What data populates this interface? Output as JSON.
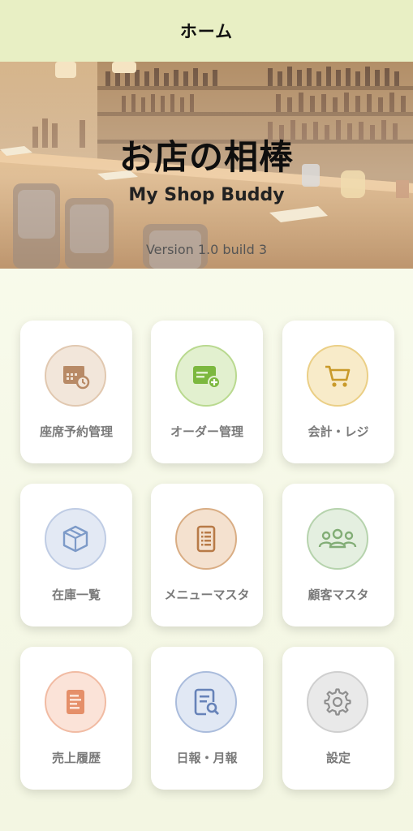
{
  "header": {
    "title": "ホーム"
  },
  "hero": {
    "title": "お店の相棒",
    "subtitle": "My Shop Buddy",
    "version": "Version 1.0 build 3"
  },
  "menu": [
    {
      "label": "座席予約管理",
      "icon": "calendar-clock-icon",
      "circle_bg": "#f2e6da",
      "circle_border": "#e1c8b0",
      "icon_color": "#b88a66"
    },
    {
      "label": "オーダー管理",
      "icon": "order-add-icon",
      "circle_bg": "#e2f0cf",
      "circle_border": "#b9d98f",
      "icon_color": "#7cb83f"
    },
    {
      "label": "会計・レジ",
      "icon": "shopping-cart-icon",
      "circle_bg": "#f8ebc9",
      "circle_border": "#ebcf86",
      "icon_color": "#c99a2a"
    },
    {
      "label": "在庫一覧",
      "icon": "box-icon",
      "circle_bg": "#e3e9f4",
      "circle_border": "#bfcce4",
      "icon_color": "#7d9ac8"
    },
    {
      "label": "メニューマスタ",
      "icon": "menu-list-icon",
      "circle_bg": "#f4e1cf",
      "circle_border": "#d9ad84",
      "icon_color": "#b87a47"
    },
    {
      "label": "顧客マスタ",
      "icon": "customers-icon",
      "circle_bg": "#e4efe0",
      "circle_border": "#b6d3ad",
      "icon_color": "#82ad76"
    },
    {
      "label": "売上履歴",
      "icon": "sales-document-icon",
      "circle_bg": "#fbe3d8",
      "circle_border": "#f1bba3",
      "icon_color": "#e58f69"
    },
    {
      "label": "日報・月報",
      "icon": "report-search-icon",
      "circle_bg": "#e1e8f4",
      "circle_border": "#aabcdc",
      "icon_color": "#6682b8"
    },
    {
      "label": "設定",
      "icon": "gear-icon",
      "circle_bg": "#e9e9e9",
      "circle_border": "#cfcfcf",
      "icon_color": "#8f8f8f"
    }
  ]
}
